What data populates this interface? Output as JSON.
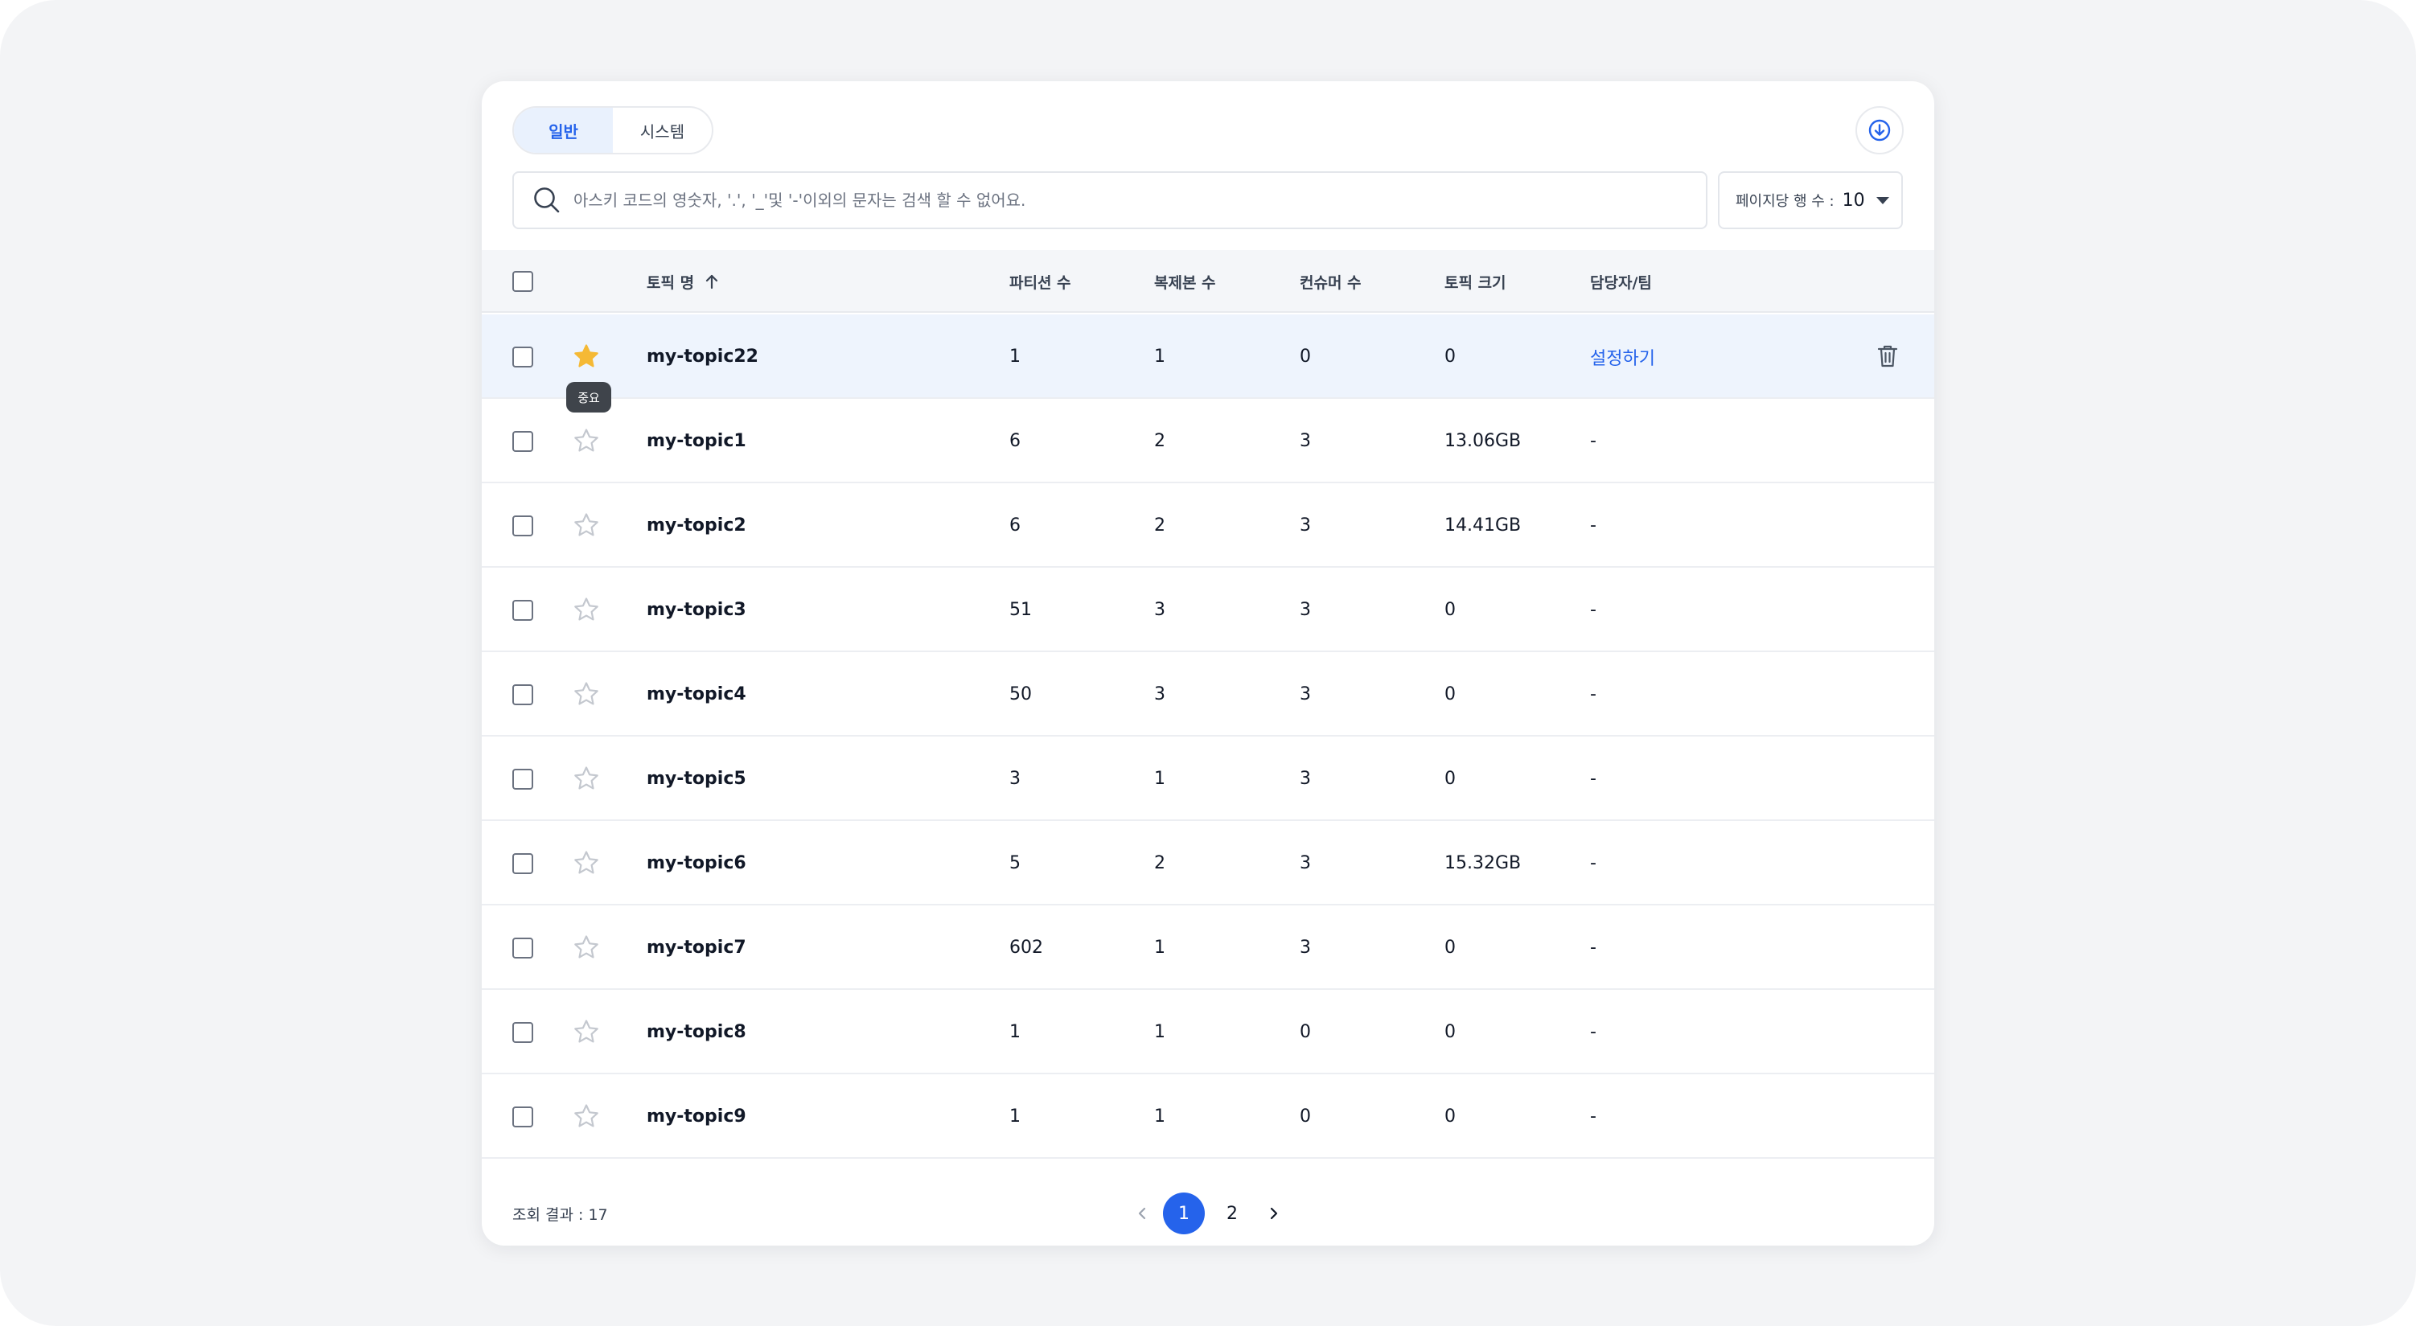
{
  "tabs": [
    {
      "label": "일반",
      "active": true
    },
    {
      "label": "시스템",
      "active": false
    }
  ],
  "search": {
    "placeholder": "아스키 코드의 영숫자, '.', '_'및 '-'이외의 문자는 검색 할 수 없어요."
  },
  "rows_per_page": {
    "label": "페이지당 행 수 :",
    "value": "10"
  },
  "columns": [
    "토픽 명",
    "파티션 수",
    "복제본 수",
    "컨슈머 수",
    "토픽 크기",
    "담당자/팀"
  ],
  "tooltip": "중요",
  "rows": [
    {
      "name": "my-topic22",
      "partitions": "1",
      "replicas": "1",
      "consumers": "0",
      "size": "0",
      "owner": "설정하기",
      "starred": true
    },
    {
      "name": "my-topic1",
      "partitions": "6",
      "replicas": "2",
      "consumers": "3",
      "size": "13.06GB",
      "owner": "-",
      "starred": false
    },
    {
      "name": "my-topic2",
      "partitions": "6",
      "replicas": "2",
      "consumers": "3",
      "size": "14.41GB",
      "owner": "-",
      "starred": false
    },
    {
      "name": "my-topic3",
      "partitions": "51",
      "replicas": "3",
      "consumers": "3",
      "size": "0",
      "owner": "-",
      "starred": false
    },
    {
      "name": "my-topic4",
      "partitions": "50",
      "replicas": "3",
      "consumers": "3",
      "size": "0",
      "owner": "-",
      "starred": false
    },
    {
      "name": "my-topic5",
      "partitions": "3",
      "replicas": "1",
      "consumers": "3",
      "size": "0",
      "owner": "-",
      "starred": false
    },
    {
      "name": "my-topic6",
      "partitions": "5",
      "replicas": "2",
      "consumers": "3",
      "size": "15.32GB",
      "owner": "-",
      "starred": false
    },
    {
      "name": "my-topic7",
      "partitions": "602",
      "replicas": "1",
      "consumers": "3",
      "size": "0",
      "owner": "-",
      "starred": false
    },
    {
      "name": "my-topic8",
      "partitions": "1",
      "replicas": "1",
      "consumers": "0",
      "size": "0",
      "owner": "-",
      "starred": false
    },
    {
      "name": "my-topic9",
      "partitions": "1",
      "replicas": "1",
      "consumers": "0",
      "size": "0",
      "owner": "-",
      "starred": false
    }
  ],
  "footer": {
    "result_label": "조회 결과 : 17",
    "pages": [
      "1",
      "2"
    ],
    "current_page": "1"
  },
  "colors": {
    "accent": "#2563eb",
    "star_active": "#f5b935",
    "star_inactive": "#c4c8cf",
    "highlight_row": "#eef4fd"
  },
  "icons": {
    "search": "search-icon",
    "download": "download-circle-icon",
    "star": "star-icon",
    "trash": "trash-icon",
    "sort": "arrow-up-icon"
  }
}
